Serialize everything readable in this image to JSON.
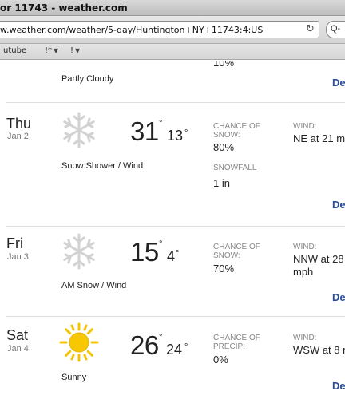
{
  "window": {
    "title": "or 11743 - weather.com"
  },
  "browser": {
    "url": "w.weather.com/weather/5-day/Huntington+NY+11743:4:US",
    "search_label": "Q-",
    "bookmarks": [
      {
        "label": "utube"
      },
      {
        "label": "!*"
      },
      {
        "label": "!"
      }
    ]
  },
  "top_partial": {
    "chance_value": "10%",
    "condition": "Partly Cloudy",
    "details_label": "De"
  },
  "forecast": [
    {
      "day": "Thu",
      "date": "Jan 2",
      "icon": "snowflake-icon",
      "condition": "Snow Shower / Wind",
      "high": "31",
      "low": "13",
      "degree": "°",
      "chance_label_1": "CHANCE OF",
      "chance_label_2": "SNOW:",
      "chance_value": "80%",
      "extra_label": "SNOWFALL",
      "extra_value": "1 in",
      "wind_label": "WIND:",
      "wind_value_1": "NE at 21 m",
      "wind_value_2": "",
      "details_label": "De"
    },
    {
      "day": "Fri",
      "date": "Jan 3",
      "icon": "snowflake-icon",
      "condition": "AM Snow / Wind",
      "high": "15",
      "low": "4",
      "degree": "°",
      "chance_label_1": "CHANCE OF",
      "chance_label_2": "SNOW:",
      "chance_value": "70%",
      "wind_label": "WIND:",
      "wind_value_1": "NNW at 28",
      "wind_value_2": "mph",
      "details_label": "De"
    },
    {
      "day": "Sat",
      "date": "Jan 4",
      "icon": "sun-icon",
      "condition": "Sunny",
      "high": "26",
      "low": "24",
      "degree": "°",
      "chance_label_1": "CHANCE OF",
      "chance_label_2": "PRECIP:",
      "chance_value": "0%",
      "wind_label": "WIND:",
      "wind_value_1": "WSW at 8 m",
      "wind_value_2": "",
      "details_label": "De"
    }
  ],
  "colors": {
    "link": "#2a4d9b",
    "label_gray": "#888888",
    "separator": "#dedede",
    "sun": "#f5c400"
  }
}
